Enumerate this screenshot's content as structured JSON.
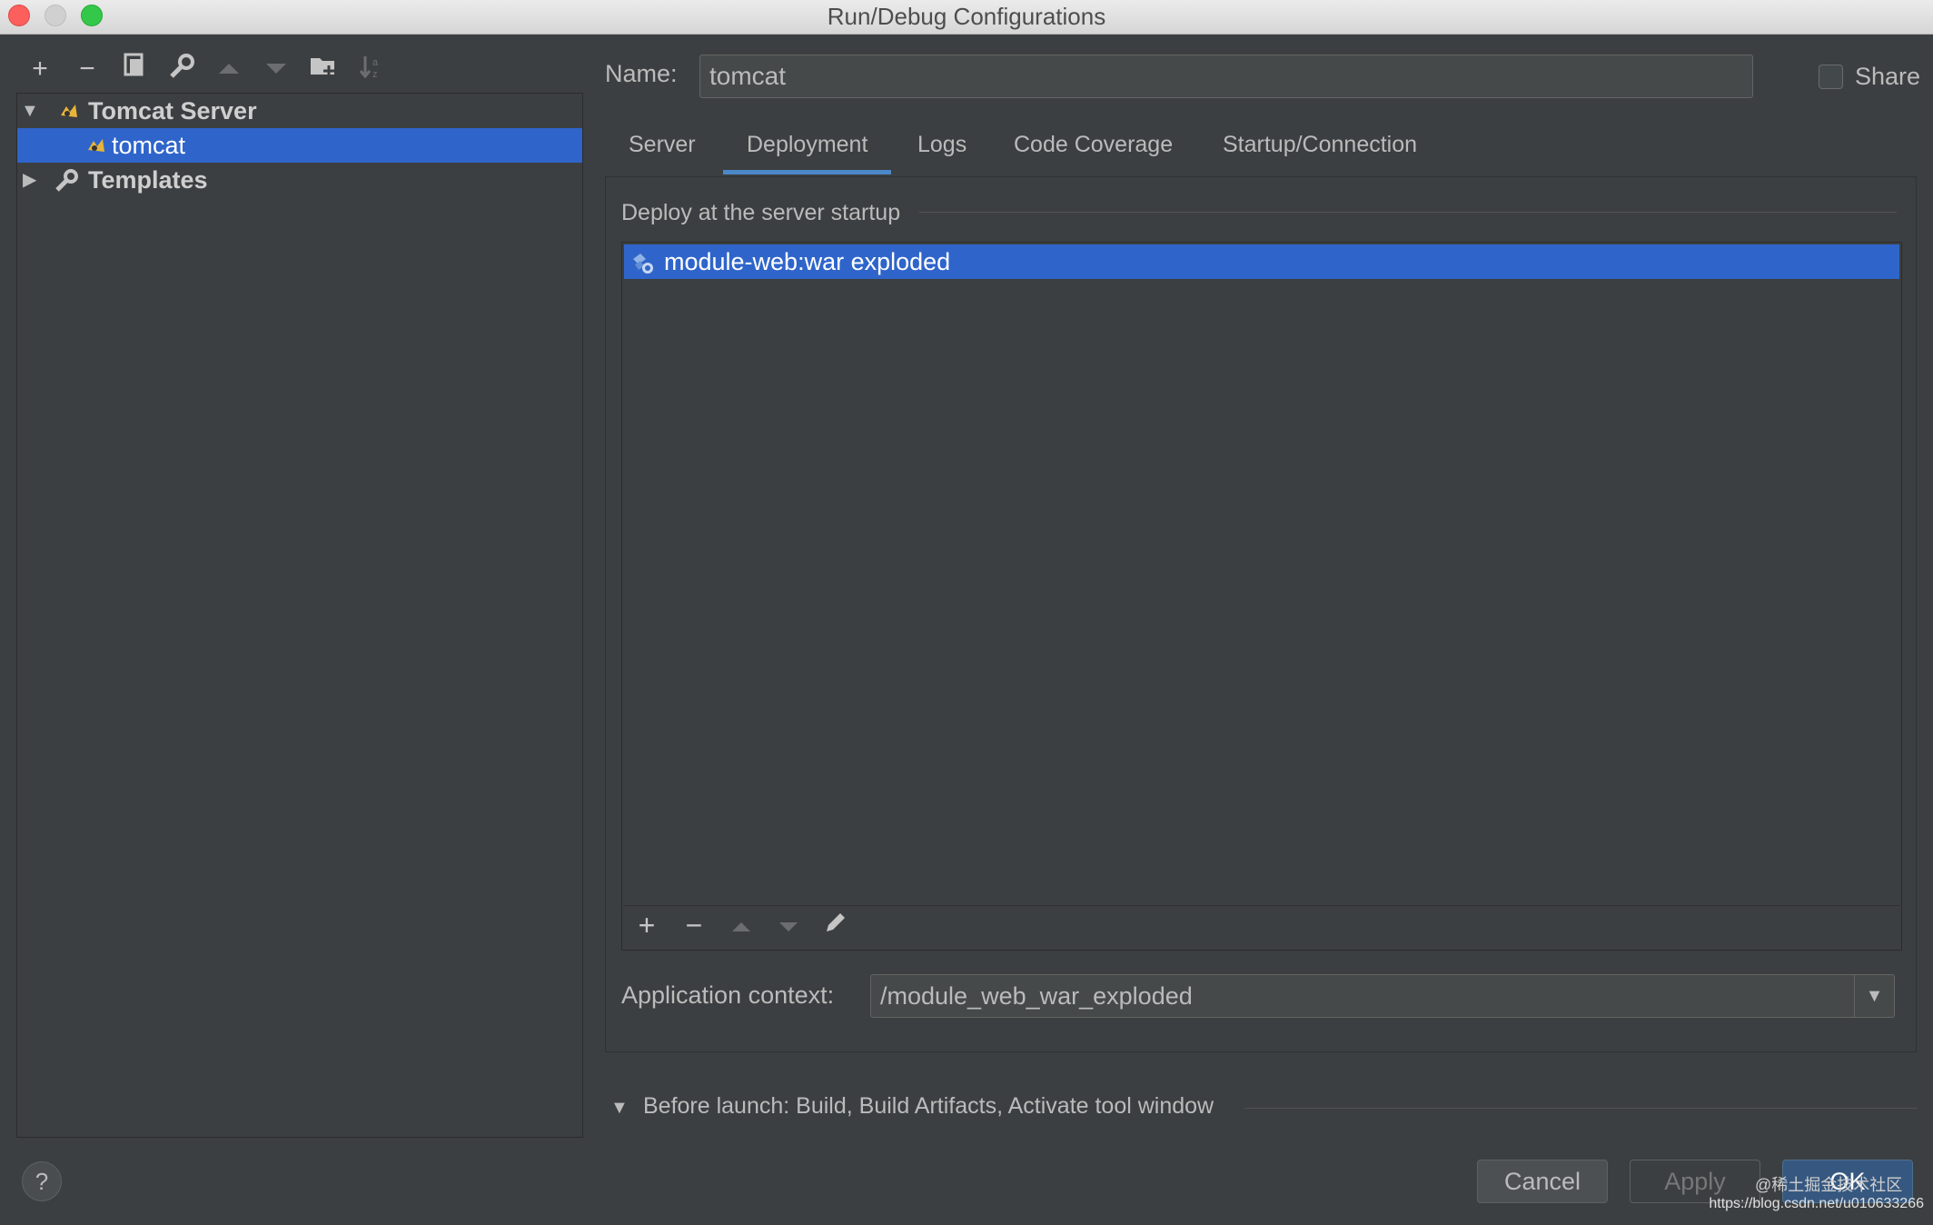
{
  "window": {
    "title": "Run/Debug Configurations"
  },
  "toolbar": {
    "icons": [
      "plus-icon",
      "minus-icon",
      "copy-icon",
      "wrench-icon",
      "move-up-icon",
      "move-down-icon",
      "new-folder-icon",
      "sort-icon"
    ]
  },
  "tree": {
    "group_label": "Tomcat Server",
    "item_label": "tomcat",
    "templates_label": "Templates"
  },
  "name_field": {
    "label": "Name:",
    "value": "tomcat"
  },
  "share": {
    "label": "Share",
    "checked": false
  },
  "tabs": [
    {
      "label": "Server"
    },
    {
      "label": "Deployment",
      "active": true
    },
    {
      "label": "Logs"
    },
    {
      "label": "Code Coverage"
    },
    {
      "label": "Startup/Connection"
    }
  ],
  "deployment": {
    "section_title": "Deploy at the server startup",
    "items": [
      "module-web:war exploded"
    ],
    "context_label": "Application context:",
    "context_value": "/module_web_war_exploded"
  },
  "before_launch": {
    "label": "Before launch: Build, Build Artifacts, Activate tool window"
  },
  "buttons": {
    "help": "?",
    "cancel": "Cancel",
    "apply": "Apply",
    "ok": "OK"
  },
  "watermark": {
    "line1": "@稀土掘金技术社区",
    "line2": "https://blog.csdn.net/u010633266"
  },
  "colors": {
    "selection": "#2f65ca",
    "background": "#3c3f41",
    "accent": "#4a88c7"
  }
}
